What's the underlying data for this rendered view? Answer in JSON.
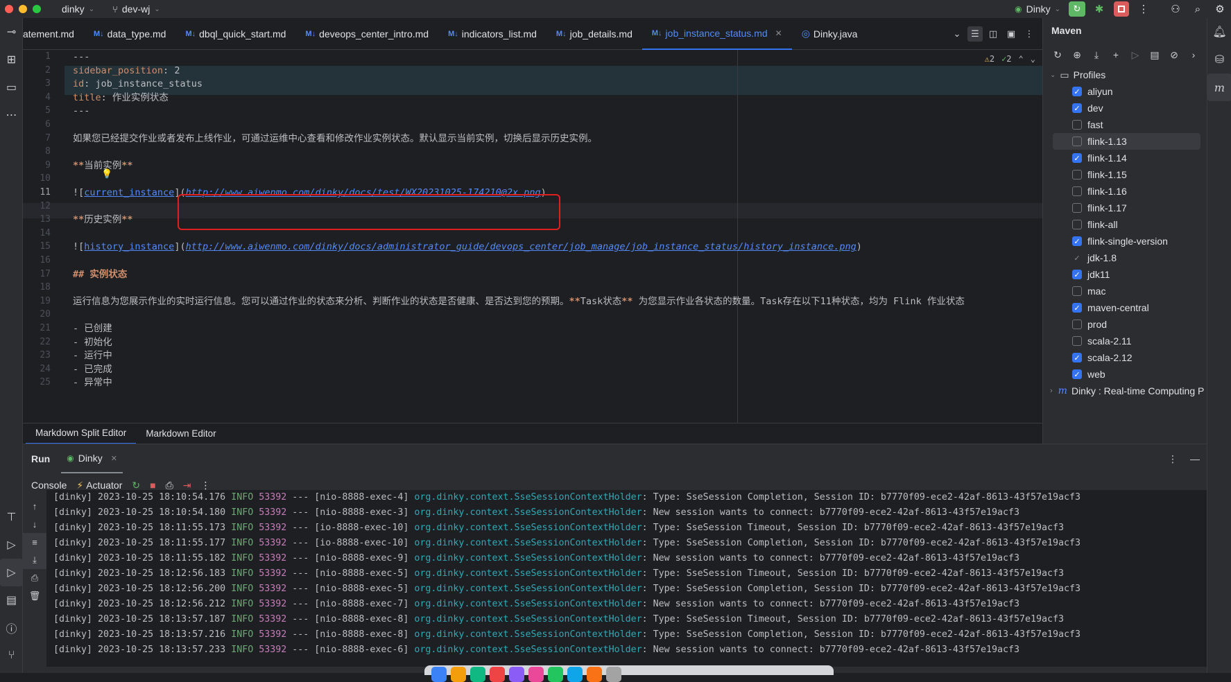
{
  "titlebar": {
    "project": "dinky",
    "branch": "dev-wj",
    "run_config": "Dinky"
  },
  "tabs": [
    {
      "label": "atement.md",
      "active": false
    },
    {
      "label": "data_type.md",
      "active": false
    },
    {
      "label": "dbql_quick_start.md",
      "active": false
    },
    {
      "label": "deveops_center_intro.md",
      "active": false
    },
    {
      "label": "indicators_list.md",
      "active": false
    },
    {
      "label": "job_details.md",
      "active": false
    },
    {
      "label": "job_instance_status.md",
      "active": true
    },
    {
      "label": "Dinky.java",
      "active": false
    }
  ],
  "tab_md_prefix": "M↓",
  "inspections": {
    "warnings": "2",
    "weak": "2"
  },
  "editor": {
    "lines": [
      {
        "n": "1",
        "text": "---"
      },
      {
        "n": "2",
        "key": "sidebar_position",
        "val": " 2"
      },
      {
        "n": "3",
        "key": "id",
        "val": " job_instance_status"
      },
      {
        "n": "4",
        "key": "title",
        "val": " 作业实例状态"
      },
      {
        "n": "5",
        "text": "---"
      },
      {
        "n": "6",
        "text": ""
      },
      {
        "n": "7",
        "text": "如果您已经提交作业或者发布上线作业，可通过运维中心查看和修改作业实例状态。默认显示当前实例，切换后显示历史实例。"
      },
      {
        "n": "8",
        "text": ""
      },
      {
        "n": "9",
        "bold": "当前实例"
      },
      {
        "n": "10",
        "text": ""
      },
      {
        "n": "11",
        "alt": "current_instance",
        "url": "http://www.aiwenmo.com/dinky/docs/test/WX20231025-174210@2x.png"
      },
      {
        "n": "12",
        "text": ""
      },
      {
        "n": "13",
        "bold": "历史实例"
      },
      {
        "n": "14",
        "text": ""
      },
      {
        "n": "15",
        "alt": "history_instance",
        "url": "http://www.aiwenmo.com/dinky/docs/administrator_guide/devops_center/job_manage/job_instance_status/history_instance.png"
      },
      {
        "n": "16",
        "text": ""
      },
      {
        "n": "17",
        "heading": "实例状态"
      },
      {
        "n": "18",
        "text": ""
      },
      {
        "n": "19",
        "pre": "运行信息为您展示作业的实时运行信息。您可以通过作业的状态来分析、判断作业的状态是否健康、是否达到您的预期。",
        "bold": "Task状态",
        "post": " 为您显示作业各状态的数量。Task存在以下11种状态，均为 Flink 作业状态"
      },
      {
        "n": "20",
        "text": ""
      },
      {
        "n": "21",
        "text": "- 已创建"
      },
      {
        "n": "22",
        "text": "- 初始化"
      },
      {
        "n": "23",
        "text": "- 运行中"
      },
      {
        "n": "24",
        "text": "- 已完成"
      },
      {
        "n": "25",
        "text": "- 异常中"
      }
    ]
  },
  "md_tabs": [
    "Markdown Split Editor",
    "Markdown Editor"
  ],
  "maven": {
    "title": "Maven",
    "profiles_label": "Profiles",
    "profiles": [
      {
        "name": "aliyun",
        "state": "on"
      },
      {
        "name": "dev",
        "state": "on"
      },
      {
        "name": "fast",
        "state": "off"
      },
      {
        "name": "flink-1.13",
        "state": "off",
        "selected": true
      },
      {
        "name": "flink-1.14",
        "state": "on"
      },
      {
        "name": "flink-1.15",
        "state": "off"
      },
      {
        "name": "flink-1.16",
        "state": "off"
      },
      {
        "name": "flink-1.17",
        "state": "off"
      },
      {
        "name": "flink-all",
        "state": "off"
      },
      {
        "name": "flink-single-version",
        "state": "on"
      },
      {
        "name": "jdk-1.8",
        "state": "part"
      },
      {
        "name": "jdk11",
        "state": "on"
      },
      {
        "name": "mac",
        "state": "off"
      },
      {
        "name": "maven-central",
        "state": "on"
      },
      {
        "name": "prod",
        "state": "off"
      },
      {
        "name": "scala-2.11",
        "state": "off"
      },
      {
        "name": "scala-2.12",
        "state": "on"
      },
      {
        "name": "web",
        "state": "on"
      }
    ],
    "project": "Dinky : Real-time Computing P"
  },
  "run": {
    "label": "Run",
    "config": "Dinky",
    "console": "Console",
    "actuator": "Actuator"
  },
  "console_lines": [
    {
      "pfx": "[dinky] 2023-10-25 18:10:54.176 ",
      "lvl": "INFO",
      "pid": "53392",
      "thread": " --- [nio-8888-exec-4] ",
      "cls": "org.dinky.context.SseSessionContextHolder",
      "msg": ": Type: SseSession Completion, Session ID: b7770f09-ece2-42af-8613-43f57e19acf3"
    },
    {
      "pfx": "[dinky] 2023-10-25 18:10:54.180 ",
      "lvl": "INFO",
      "pid": "53392",
      "thread": " --- [nio-8888-exec-3] ",
      "cls": "org.dinky.context.SseSessionContextHolder",
      "msg": ": New session wants to connect: b7770f09-ece2-42af-8613-43f57e19acf3"
    },
    {
      "pfx": "[dinky] 2023-10-25 18:11:55.173 ",
      "lvl": "INFO",
      "pid": "53392",
      "thread": " --- [io-8888-exec-10] ",
      "cls": "org.dinky.context.SseSessionContextHolder",
      "msg": ": Type: SseSession Timeout, Session ID: b7770f09-ece2-42af-8613-43f57e19acf3"
    },
    {
      "pfx": "[dinky] 2023-10-25 18:11:55.177 ",
      "lvl": "INFO",
      "pid": "53392",
      "thread": " --- [io-8888-exec-10] ",
      "cls": "org.dinky.context.SseSessionContextHolder",
      "msg": ": Type: SseSession Completion, Session ID: b7770f09-ece2-42af-8613-43f57e19acf3"
    },
    {
      "pfx": "[dinky] 2023-10-25 18:11:55.182 ",
      "lvl": "INFO",
      "pid": "53392",
      "thread": " --- [nio-8888-exec-9] ",
      "cls": "org.dinky.context.SseSessionContextHolder",
      "msg": ": New session wants to connect: b7770f09-ece2-42af-8613-43f57e19acf3"
    },
    {
      "pfx": "[dinky] 2023-10-25 18:12:56.183 ",
      "lvl": "INFO",
      "pid": "53392",
      "thread": " --- [nio-8888-exec-5] ",
      "cls": "org.dinky.context.SseSessionContextHolder",
      "msg": ": Type: SseSession Timeout, Session ID: b7770f09-ece2-42af-8613-43f57e19acf3"
    },
    {
      "pfx": "[dinky] 2023-10-25 18:12:56.200 ",
      "lvl": "INFO",
      "pid": "53392",
      "thread": " --- [nio-8888-exec-5] ",
      "cls": "org.dinky.context.SseSessionContextHolder",
      "msg": ": Type: SseSession Completion, Session ID: b7770f09-ece2-42af-8613-43f57e19acf3"
    },
    {
      "pfx": "[dinky] 2023-10-25 18:12:56.212 ",
      "lvl": "INFO",
      "pid": "53392",
      "thread": " --- [nio-8888-exec-7] ",
      "cls": "org.dinky.context.SseSessionContextHolder",
      "msg": ": New session wants to connect: b7770f09-ece2-42af-8613-43f57e19acf3"
    },
    {
      "pfx": "[dinky] 2023-10-25 18:13:57.187 ",
      "lvl": "INFO",
      "pid": "53392",
      "thread": " --- [nio-8888-exec-8] ",
      "cls": "org.dinky.context.SseSessionContextHolder",
      "msg": ": Type: SseSession Timeout, Session ID: b7770f09-ece2-42af-8613-43f57e19acf3"
    },
    {
      "pfx": "[dinky] 2023-10-25 18:13:57.216 ",
      "lvl": "INFO",
      "pid": "53392",
      "thread": " --- [nio-8888-exec-8] ",
      "cls": "org.dinky.context.SseSessionContextHolder",
      "msg": ": Type: SseSession Completion, Session ID: b7770f09-ece2-42af-8613-43f57e19acf3"
    },
    {
      "pfx": "[dinky] 2023-10-25 18:13:57.233 ",
      "lvl": "INFO",
      "pid": "53392",
      "thread": " --- [nio-8888-exec-6] ",
      "cls": "org.dinky.context.SseSessionContextHolder",
      "msg": ": New session wants to connect: b7770f09-ece2-42af-8613-43f57e19acf3"
    }
  ],
  "colors": {
    "accent": "#3574f0",
    "highlight_box": "#e0201e",
    "run_green": "#5fb865",
    "stop_red": "#db5c5c"
  }
}
